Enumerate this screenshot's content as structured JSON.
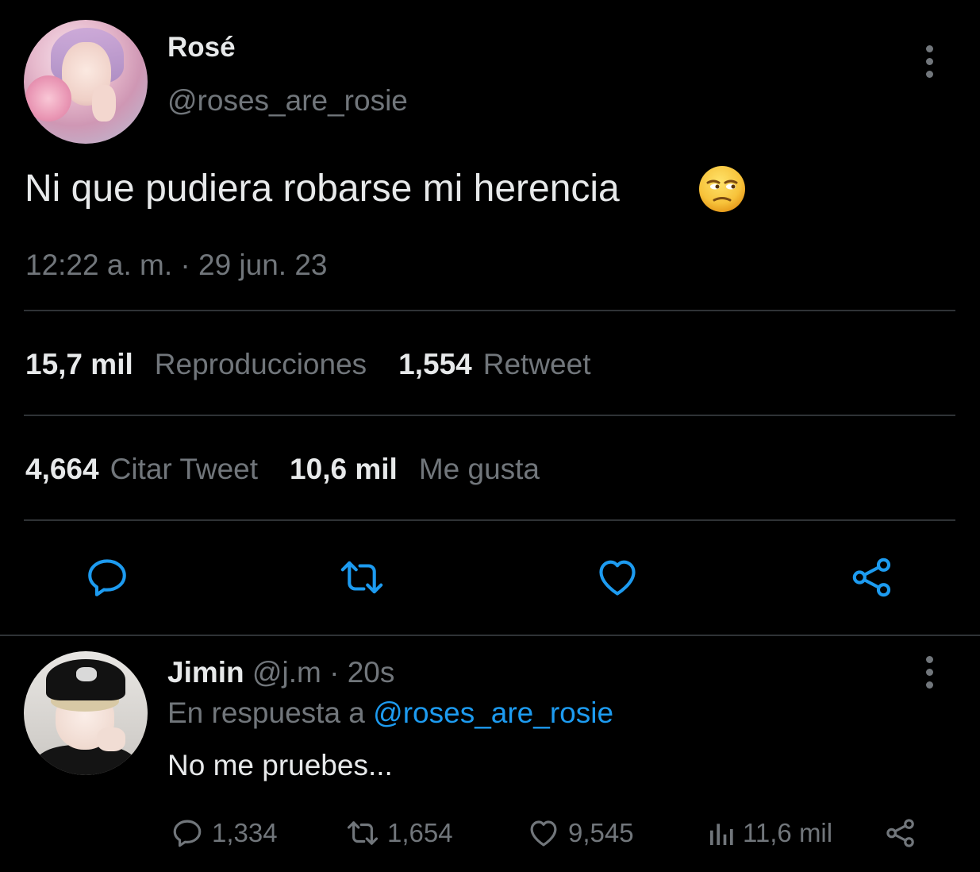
{
  "tweet": {
    "author_name": "Rosé",
    "author_handle": "@roses_are_rosie",
    "text": "Ni que pudiera robarse mi herencia",
    "emoji": "unamused-face",
    "timestamp": "12:22 a. m. · 29 jun. 23",
    "stats": {
      "views_count": "15,7 mil",
      "views_label": "Reproducciones",
      "retweets_count": "1,554",
      "retweets_label": "Retweet",
      "quotes_count": "4,664",
      "quotes_label": "Citar Tweet",
      "likes_count": "10,6 mil",
      "likes_label": "Me gusta"
    },
    "actions": [
      "reply-icon",
      "retweet-icon",
      "like-icon",
      "share-icon"
    ]
  },
  "reply": {
    "author_name": "Jimin",
    "author_handle": "@j.m",
    "time": "· 20s",
    "in_reply_prefix": "En respuesta a",
    "in_reply_mention": "@roses_are_rosie",
    "text": "No me pruebes...",
    "replies": "1,334",
    "retweets": "1,654",
    "likes": "9,545",
    "views": "11,6 mil"
  },
  "colors": {
    "background": "#000000",
    "text_primary": "#e7e9ea",
    "text_secondary": "#71767b",
    "link": "#1d9bf0",
    "divider": "#2f3336"
  }
}
